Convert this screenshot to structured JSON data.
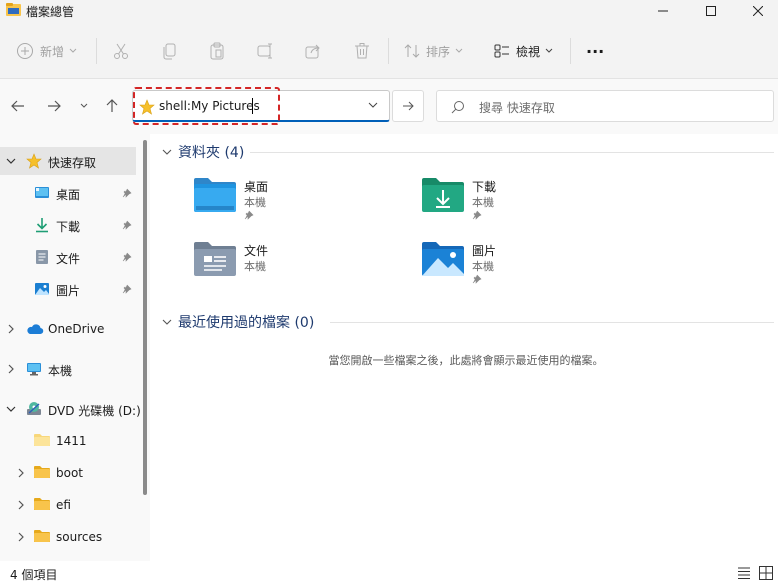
{
  "window": {
    "title": "檔案總管"
  },
  "toolbar": {
    "new_label": "新增",
    "sort_label": "排序",
    "view_label": "檢視",
    "more_label": "···"
  },
  "address": {
    "path": "shell:My Pictures",
    "search_placeholder": "搜尋 快速存取"
  },
  "sidebar": {
    "items": [
      {
        "label": "快速存取",
        "icon": "star-icon"
      },
      {
        "label": "桌面",
        "icon": "desktop-icon"
      },
      {
        "label": "下載",
        "icon": "download-icon"
      },
      {
        "label": "文件",
        "icon": "documents-icon"
      },
      {
        "label": "圖片",
        "icon": "pictures-icon"
      },
      {
        "label": "OneDrive",
        "icon": "cloud-icon"
      },
      {
        "label": "本機",
        "icon": "computer-icon"
      },
      {
        "label": "DVD 光碟機 (D:)",
        "icon": "dvd-icon"
      },
      {
        "label": "1411",
        "icon": "folder-icon"
      },
      {
        "label": "boot",
        "icon": "folder-icon"
      },
      {
        "label": "efi",
        "icon": "folder-icon"
      },
      {
        "label": "sources",
        "icon": "folder-icon"
      }
    ]
  },
  "main": {
    "folders_header": "資料夾 (4)",
    "recent_header": "最近使用過的檔案 (0)",
    "folders": [
      {
        "name": "桌面",
        "location": "本機"
      },
      {
        "name": "下載",
        "location": "本機"
      },
      {
        "name": "文件",
        "location": "本機"
      },
      {
        "name": "圖片",
        "location": "本機"
      }
    ],
    "empty_message": "當您開啟一些檔案之後，此處將會顯示最近使用的檔案。"
  },
  "status": {
    "item_count": "4 個項目"
  },
  "colors": {
    "accent": "#005fb8",
    "highlight": "#d32626",
    "folder": "#f8c44b"
  }
}
